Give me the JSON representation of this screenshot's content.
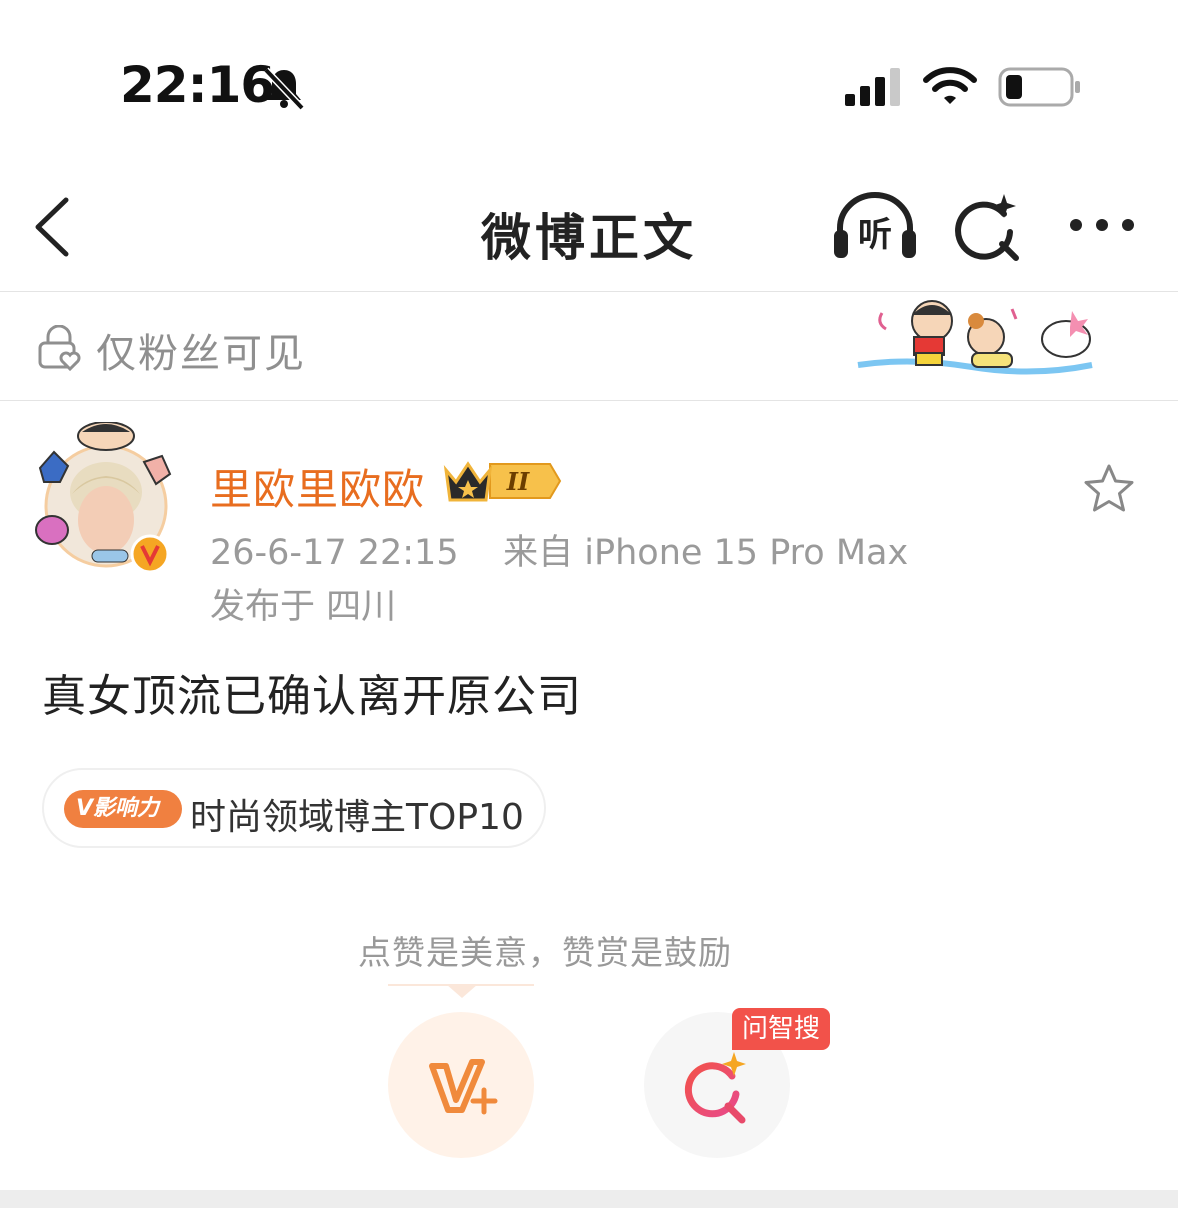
{
  "status_bar": {
    "time": "22:16",
    "icons": [
      "bell-slash-icon",
      "cellular-signal-icon",
      "wifi-icon",
      "battery-low-icon"
    ]
  },
  "nav": {
    "title": "微博正文",
    "listen_icon_label": "听",
    "icons": [
      "back-icon",
      "listen-icon",
      "ai-search-icon",
      "more-icon"
    ]
  },
  "visibility": {
    "text": "仅粉丝可见",
    "icon": "lock-heart-icon"
  },
  "post": {
    "author": "里欧里欧欧",
    "author_color": "#e86d1f",
    "member_badge": "II",
    "timestamp": "26-6-17 22:15",
    "source": "来自 iPhone 15 Pro Max",
    "location": "发布于 四川",
    "content": "真女顶流已确认离开原公司",
    "influence": {
      "badge_text": "V影响力",
      "label": "时尚领域博主TOP10",
      "badge_color": "#f08040"
    }
  },
  "reward": {
    "hint": "点赞是美意，赞赏是鼓励",
    "smart_search_badge": "问智搜"
  },
  "colors": {
    "accent": "#e86d1f",
    "badge_red": "#f2524a",
    "muted_text": "#999999"
  }
}
